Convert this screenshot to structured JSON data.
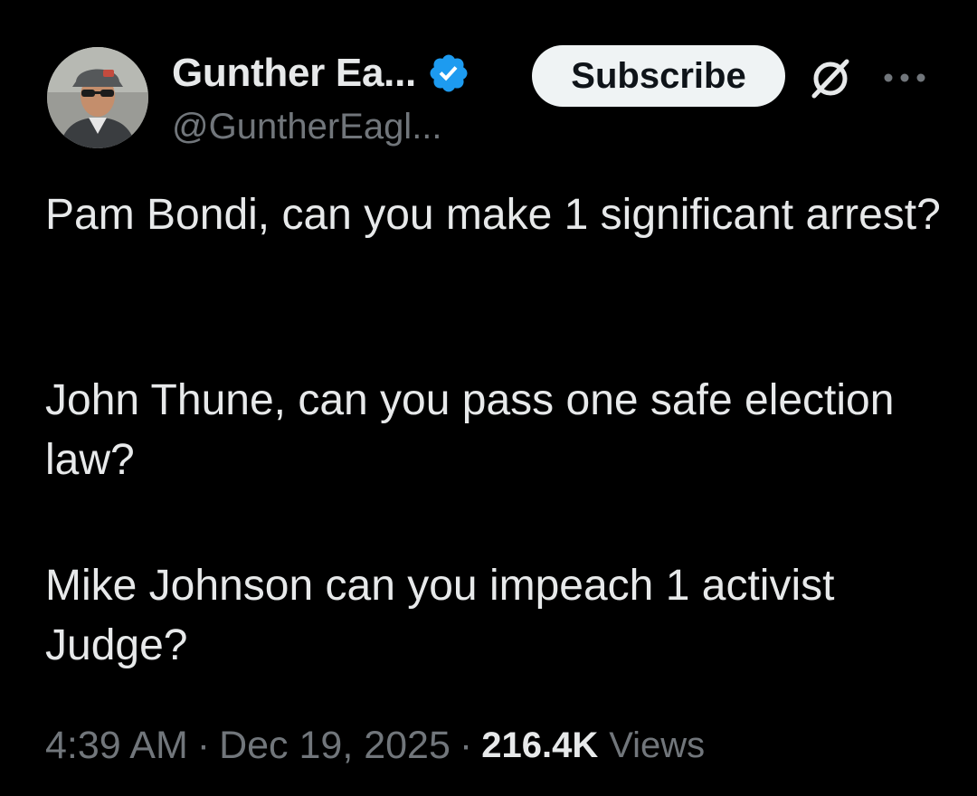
{
  "author": {
    "display_name": "Gunther Ea...",
    "handle": "@GuntherEagl...",
    "verified_badge": "verified-badge-icon",
    "verified_color": "#1d9bf0"
  },
  "actions": {
    "subscribe_label": "Subscribe",
    "grok_icon": "grok-icon",
    "more_icon": "more-options-icon"
  },
  "tweet": {
    "paragraphs": [
      "Pam Bondi, can you make 1 significant arrest?",
      "John Thune, can you pass one safe election law?",
      "Mike Johnson can you impeach 1 activist Judge?"
    ],
    "time": "4:39 AM",
    "date": "Dec 19, 2025",
    "separator": "·",
    "views_count": "216.4K",
    "views_label": "Views"
  },
  "colors": {
    "background": "#000000",
    "text_primary": "#e7e9ea",
    "text_secondary": "#71767b",
    "subscribe_bg": "#eff3f4"
  }
}
